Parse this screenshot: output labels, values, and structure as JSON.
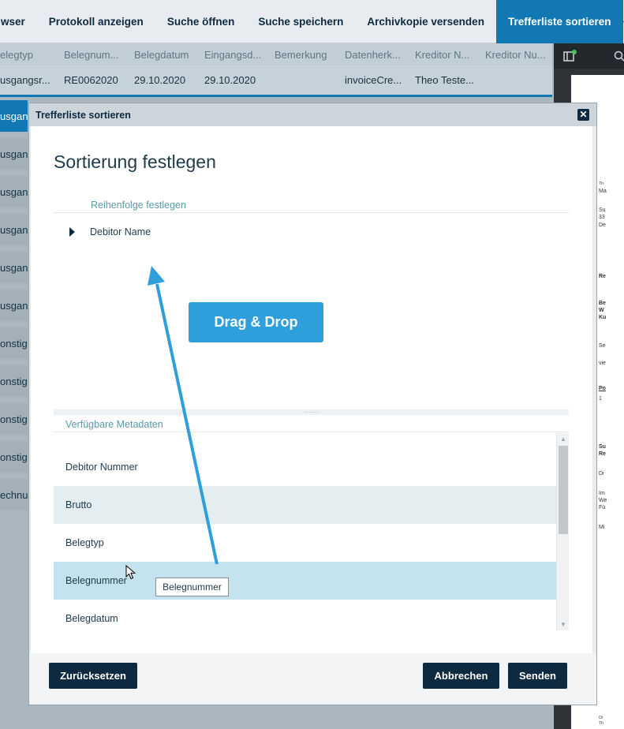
{
  "toolbar": {
    "items": [
      "wser",
      "Protokoll anzeigen",
      "Suche öffnen",
      "Suche speichern",
      "Archivkopie versenden",
      "Trefferliste sortieren"
    ],
    "more": "···"
  },
  "grid": {
    "headers": [
      "elegtyp",
      "Belegnum...",
      "Belegdatum",
      "Eingangsd...",
      "Bemerkung",
      "Datenherk...",
      "Kreditor N...",
      "Kreditor Nu..."
    ],
    "row": [
      "usgangsr...",
      "RE0062020",
      "29.10.2020",
      "29.10.2020",
      "",
      "invoiceCre...",
      "Theo Teste...",
      ""
    ],
    "left_cells": [
      "usgan",
      "usgan",
      "usgan",
      "usgan",
      "usgan",
      "usgan",
      "onstig",
      "onstig",
      "onstig",
      "onstig",
      "echnu"
    ]
  },
  "preview": {
    "lines": [
      "Th",
      "Ma",
      "Su",
      "33",
      "De",
      "Re",
      "Be",
      "W",
      "Ku",
      "Se",
      "vie",
      "Po",
      "1",
      "Su",
      "Re",
      "Di",
      "Im",
      "We",
      "Fü",
      "Mi",
      "Or",
      "Th"
    ]
  },
  "dialog": {
    "title": "Trefferliste sortieren",
    "close": "✕",
    "heading": "Sortierung festlegen",
    "order_label": "Reihenfolge festlegen",
    "sort_items": [
      "Debitor Name"
    ],
    "drag_drop": "Drag & Drop",
    "splitter": "......",
    "available_label": "Verfügbare Metadaten",
    "metadata": [
      "Debitor Nummer",
      "Brutto",
      "Belegtyp",
      "Belegnummer",
      "Belegdatum"
    ],
    "tooltip": "Belegnummer",
    "buttons": {
      "reset": "Zurücksetzen",
      "cancel": "Abbrechen",
      "send": "Senden"
    }
  },
  "colors": {
    "accent": "#1278b4",
    "drag_badge": "#2f9fdc",
    "dark_button": "#0d2a40"
  }
}
